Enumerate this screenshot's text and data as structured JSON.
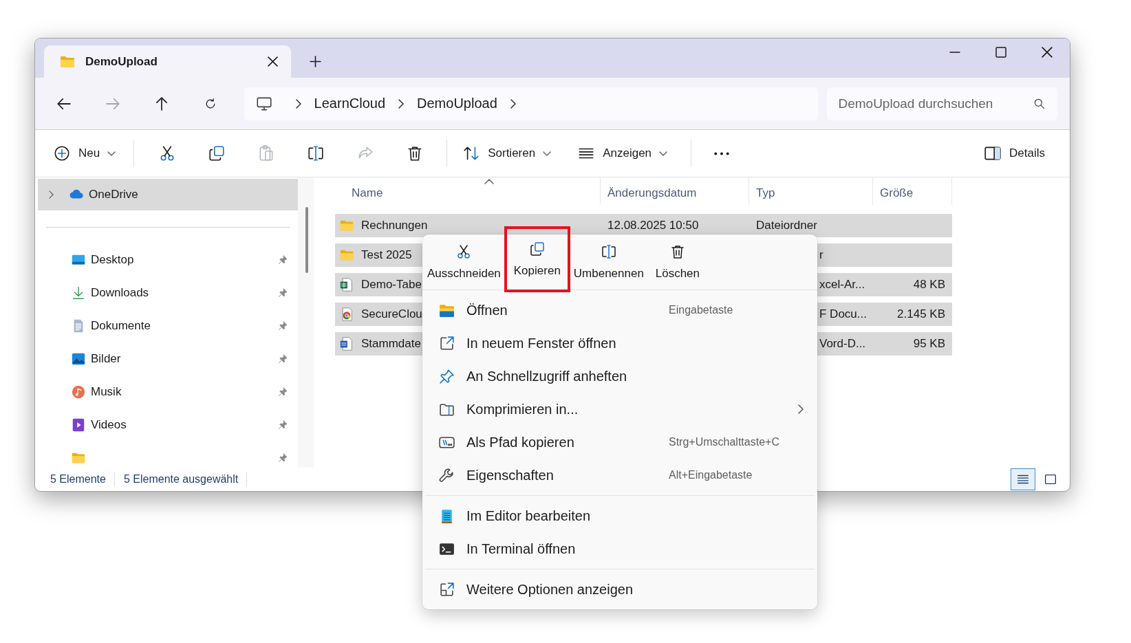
{
  "window": {
    "tab_title": "DemoUpload"
  },
  "nav_buttons": [
    {
      "kind": "back",
      "disabled": false
    },
    {
      "kind": "forward",
      "disabled": true
    },
    {
      "kind": "up",
      "disabled": false
    },
    {
      "kind": "refresh",
      "disabled": false
    }
  ],
  "breadcrumb": [
    "LearnCloud",
    "DemoUpload"
  ],
  "search": {
    "placeholder": "DemoUpload durchsuchen"
  },
  "toolbar": {
    "new_label": "Neu",
    "actions": [
      {
        "kind": "cut",
        "disabled": false
      },
      {
        "kind": "copy",
        "disabled": false
      },
      {
        "kind": "paste",
        "disabled": true
      },
      {
        "kind": "rename",
        "disabled": false
      },
      {
        "kind": "share",
        "disabled": true
      },
      {
        "kind": "delete",
        "disabled": false
      }
    ],
    "sort_label": "Sortieren",
    "view_label": "Anzeigen",
    "details_label": "Details"
  },
  "sidebar": {
    "root": {
      "label": "OneDrive",
      "kind": "cloud",
      "selected": true
    },
    "quick_access": [
      {
        "label": "Desktop",
        "kind": "desktop"
      },
      {
        "label": "Downloads",
        "kind": "downloads"
      },
      {
        "label": "Dokumente",
        "kind": "documents"
      },
      {
        "label": "Bilder",
        "kind": "pictures"
      },
      {
        "label": "Musik",
        "kind": "music"
      },
      {
        "label": "Videos",
        "kind": "videos"
      },
      {
        "kind": "folder"
      }
    ]
  },
  "file_list": {
    "columns": [
      "Name",
      "Änderungsdatum",
      "Typ",
      "Größe"
    ],
    "rows": [
      {
        "kind": "folder",
        "name": "Rechnungen",
        "date": "12.08.2025 10:50",
        "type": "Dateiordner",
        "selected": true,
        "type_cut": false
      },
      {
        "kind": "folder",
        "name": "Test 2025",
        "type": "r",
        "selected": true,
        "type_cut": true
      },
      {
        "kind": "spreadsheet",
        "name": "Demo-Tabe",
        "type": "xcel-Ar...",
        "size": "48 KB",
        "selected": true,
        "type_cut": true
      },
      {
        "kind": "web",
        "name": "SecureClou",
        "type": "F Docu...",
        "size": "2.145 KB",
        "selected": true,
        "type_cut": true
      },
      {
        "kind": "word",
        "name": "Stammdate",
        "type": "Vord-D...",
        "size": "95 KB",
        "selected": true,
        "type_cut": true
      }
    ]
  },
  "status_bar": {
    "item_count": "5 Elemente",
    "selection": "5 Elemente ausgewählt",
    "views": [
      {
        "kind": "details-view",
        "selected": true
      },
      {
        "kind": "tiles-view",
        "selected": false
      }
    ]
  },
  "context_menu": {
    "actions": [
      {
        "kind": "cut",
        "label": "Ausschneiden",
        "highlighted": false
      },
      {
        "kind": "copy",
        "label": "Kopieren",
        "highlighted": true
      },
      {
        "kind": "rename",
        "label": "Umbenennen",
        "highlighted": false
      },
      {
        "kind": "delete",
        "label": "Löschen",
        "highlighted": false
      }
    ],
    "groups": [
      [
        {
          "kind": "folder-open",
          "label": "Öffnen",
          "shortcut": "Eingabetaste"
        },
        {
          "kind": "new-window",
          "label": "In neuem Fenster öffnen"
        },
        {
          "kind": "pin",
          "label": "An Schnellzugriff anheften"
        },
        {
          "kind": "zip",
          "label": "Komprimieren in...",
          "submenu": true
        },
        {
          "kind": "path",
          "label": "Als Pfad kopieren",
          "shortcut": "Strg+Umschalttaste+C"
        },
        {
          "kind": "wrench",
          "label": "Eigenschaften",
          "shortcut": "Alt+Eingabetaste"
        }
      ],
      [
        {
          "kind": "notepad",
          "label": "Im Editor bearbeiten"
        },
        {
          "kind": "terminal",
          "label": "In Terminal öffnen"
        }
      ],
      [
        {
          "kind": "more-options",
          "label": "Weitere Optionen anzeigen"
        }
      ]
    ]
  }
}
